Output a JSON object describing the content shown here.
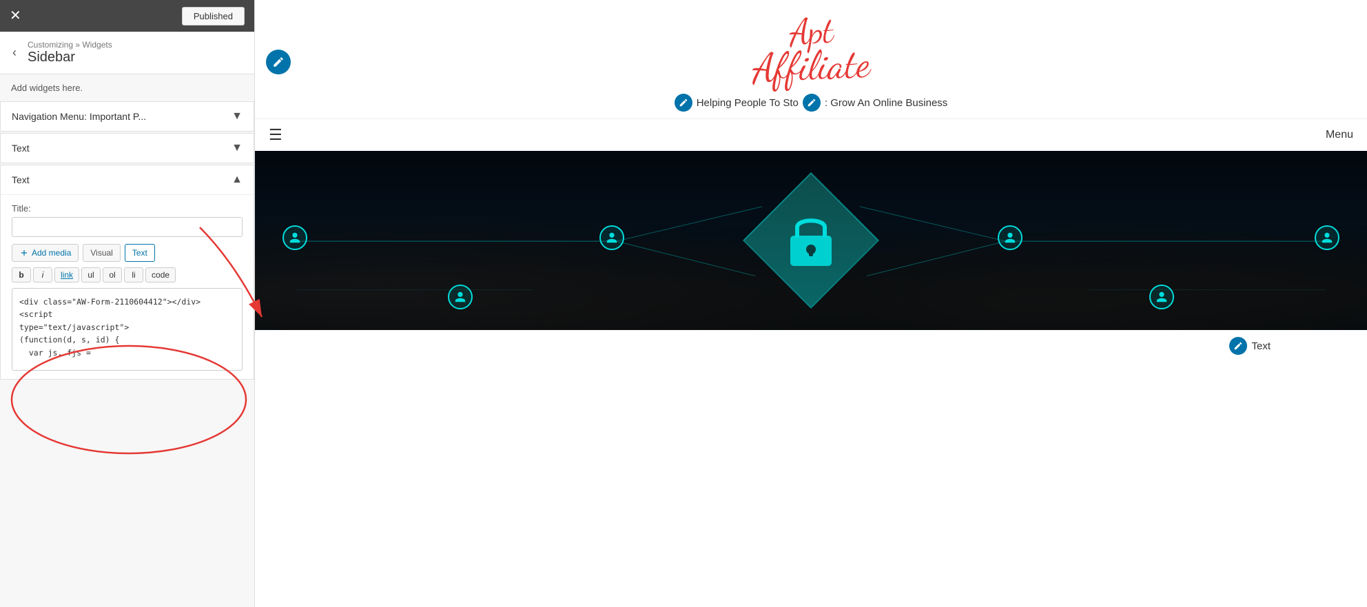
{
  "topBar": {
    "closeLabel": "✕",
    "publishedLabel": "Published"
  },
  "breadcrumb": {
    "backLabel": "‹",
    "crumbText": "Customizing » Widgets",
    "title": "Sidebar"
  },
  "widgetsBody": {
    "addWidgetsLabel": "Add widgets here.",
    "items": [
      {
        "label": "Navigation Menu: Important P...",
        "expanded": false,
        "chevron": "▼"
      },
      {
        "label": "Text",
        "expanded": false,
        "chevron": "▼"
      },
      {
        "label": "Text",
        "expanded": true,
        "chevron": "▲"
      }
    ]
  },
  "expandedWidget": {
    "titleLabel": "Title:",
    "titlePlaceholder": "",
    "addMediaLabel": "Add media",
    "visualTabLabel": "Visual",
    "textTabLabel": "Text",
    "formatButtons": [
      "b",
      "i",
      "link",
      "ul",
      "ol",
      "li",
      "code"
    ],
    "codeContent": "<div class=\"AW-Form-2110604412\"></div>\n<script\ntype=\"text/javascript\">\n(function(d, s, id) {\n  var js, fjs ="
  },
  "site": {
    "logoTop": "Apt",
    "logoBottom": "Affiliate",
    "tagline": "Helping People To Sto",
    "taglineSuffix": ": Grow An Online Business",
    "menuLabel": "Menu",
    "textBadgeLabel": "Text"
  }
}
